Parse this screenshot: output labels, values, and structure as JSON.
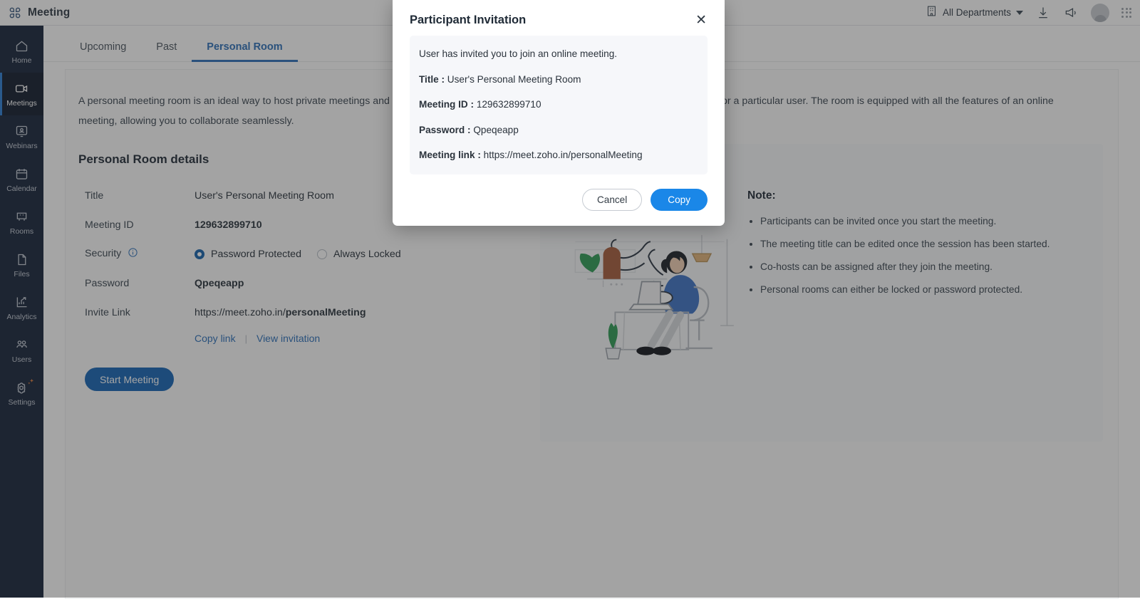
{
  "header": {
    "brand": "Meeting",
    "brand_icon": "zoho-meeting-logo-icon",
    "department": "All Departments",
    "department_icon": "building-icon",
    "download_icon": "download-icon",
    "announce_icon": "megaphone-icon",
    "avatar_icon": "user-avatar",
    "apps_icon": "app-grid-icon"
  },
  "sidebar": {
    "items": [
      {
        "label": "Home",
        "icon": "home-icon",
        "active": false
      },
      {
        "label": "Meetings",
        "icon": "video-camera-icon",
        "active": true
      },
      {
        "label": "Webinars",
        "icon": "webinar-icon",
        "active": false
      },
      {
        "label": "Calendar",
        "icon": "calendar-icon",
        "active": false
      },
      {
        "label": "Rooms",
        "icon": "rooms-icon",
        "active": false
      },
      {
        "label": "Files",
        "icon": "file-icon",
        "active": false
      },
      {
        "label": "Analytics",
        "icon": "analytics-icon",
        "active": false
      },
      {
        "label": "Users",
        "icon": "users-icon",
        "active": false
      },
      {
        "label": "Settings",
        "icon": "gear-icon",
        "active": false
      }
    ]
  },
  "tabs": [
    {
      "label": "Upcoming",
      "active": false
    },
    {
      "label": "Past",
      "active": false
    },
    {
      "label": "Personal Room",
      "active": true
    }
  ],
  "main": {
    "intro": "A personal meeting room is an ideal way to host private meetings and conversations. It is accessible only through a unique link that is reserved for a particular user. The room is equipped with all the features of an online meeting, allowing you to collaborate seamlessly.",
    "section_title": "Personal Room details",
    "details": [
      {
        "label": "Title",
        "value": "User's Personal Meeting Room"
      },
      {
        "label": "Meeting ID",
        "value": "129632899710"
      },
      {
        "label": "Security",
        "value": ""
      },
      {
        "label": "Password",
        "value": "Qpeqeapp"
      },
      {
        "label": "Invite Link",
        "value": "https://meet.zoho.in/personalMeeting"
      }
    ],
    "invite_link_prefix": "https://meet.zoho.in/",
    "invite_link_slug": "personalMeeting",
    "security_options": [
      {
        "label": "Password Protected",
        "selected": true
      },
      {
        "label": "Always Locked",
        "selected": false
      }
    ],
    "security_info_icon": "info-icon",
    "copy_link": "Copy link",
    "link_separator": "|",
    "view_invitation": "View invitation",
    "start_meeting": "Start Meeting",
    "illustration_icon": "people-high-five-illustration"
  },
  "note": {
    "heading": "Note:",
    "items": [
      "Participants can be invited once you start the meeting.",
      "The meeting title can be edited once the session has been started.",
      "Co-hosts can be assigned after they join the meeting.",
      "Personal rooms can either be locked or password protected."
    ]
  },
  "modal": {
    "title": "Participant Invitation",
    "close_icon": "close-icon",
    "intro": "User has invited you to join an online meeting.",
    "fields": [
      {
        "label": "Title :",
        "value": "User's Personal Meeting Room"
      },
      {
        "label": "Meeting ID :",
        "value": "129632899710"
      },
      {
        "label": "Password :",
        "value": "Qpeqeapp"
      },
      {
        "label": "Meeting link :",
        "value": "https://meet.zoho.in/personalMeeting"
      }
    ],
    "cancel_label": "Cancel",
    "copy_label": "Copy"
  },
  "colors": {
    "sidebar_bg": "#15233a",
    "accent_blue": "#2b6fb8",
    "primary_button": "#1565b5",
    "copy_button": "#1a87e8"
  }
}
